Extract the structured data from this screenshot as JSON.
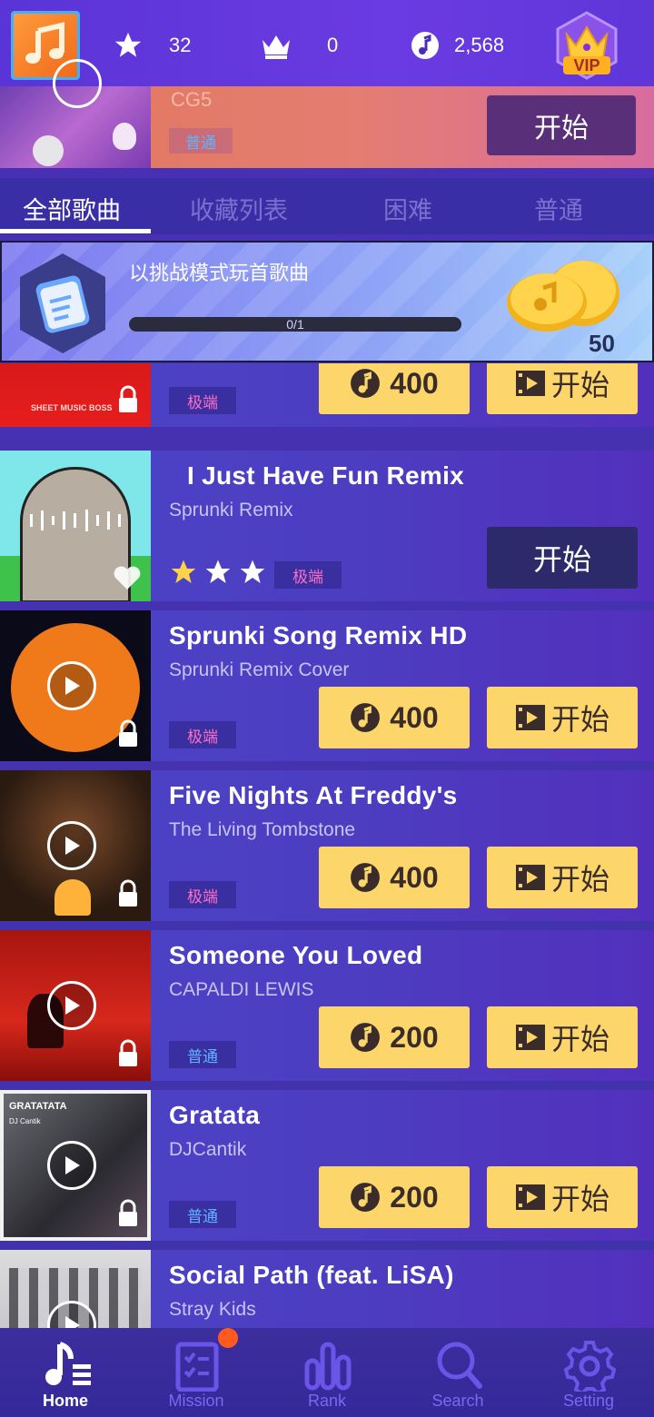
{
  "header": {
    "stars": "32",
    "crowns": "0",
    "notes": "2,568",
    "vip_label": "VIP"
  },
  "featured": {
    "artist": "CG5",
    "difficulty": "普通",
    "start_label": "开始"
  },
  "tabs": [
    {
      "label": "全部歌曲",
      "active": true
    },
    {
      "label": "收藏列表",
      "active": false
    },
    {
      "label": "困难",
      "active": false
    },
    {
      "label": "普通",
      "active": false
    }
  ],
  "challenge": {
    "title": "以挑战模式玩首歌曲",
    "progress_text": "0/1",
    "progress": 0,
    "reward": "50"
  },
  "songs": [
    {
      "title": "",
      "artist": "",
      "cover_text": "SHEET MUSIC BOSS",
      "difficulty": "极端",
      "cost": "400",
      "start_label": "开始",
      "locked": true
    },
    {
      "title": "I Just Have Fun Remix",
      "artist": "Sprunki Remix",
      "difficulty": "极端",
      "start_label": "开始",
      "stars": 3,
      "unlocked": true
    },
    {
      "title": "Sprunki Song Remix HD",
      "artist": "Sprunki Remix  Cover",
      "difficulty": "极端",
      "cost": "400",
      "start_label": "开始",
      "locked": true
    },
    {
      "title": "Five Nights At Freddy's",
      "artist": "The Living Tombstone",
      "difficulty": "极端",
      "cost": "400",
      "start_label": "开始",
      "locked": true
    },
    {
      "title": "Someone You Loved",
      "artist": "CAPALDI LEWIS",
      "difficulty": "普通",
      "cost": "200",
      "start_label": "开始",
      "locked": true
    },
    {
      "title": "Gratata",
      "artist": "DJCantik",
      "cover_text_1": "GRATATATA",
      "cover_text_2": "DJ Cantik",
      "difficulty": "普通",
      "cost": "200",
      "start_label": "开始",
      "locked": true
    },
    {
      "title": "Social Path (feat. LiSA)",
      "artist": "Stray Kids"
    }
  ],
  "nav": [
    {
      "label": "Home",
      "icon": "home-note-icon",
      "active": true
    },
    {
      "label": "Mission",
      "icon": "clipboard-icon",
      "active": false
    },
    {
      "label": "Rank",
      "icon": "bar-chart-icon",
      "active": false
    },
    {
      "label": "Search",
      "icon": "search-icon",
      "active": false
    },
    {
      "label": "Setting",
      "icon": "gear-icon",
      "active": false
    }
  ],
  "colors": {
    "accent_yellow": "#fcd66a",
    "tag_extreme": "#ff6fc3",
    "tag_normal": "#5fb3ff",
    "notification": "#ff5a1f"
  }
}
